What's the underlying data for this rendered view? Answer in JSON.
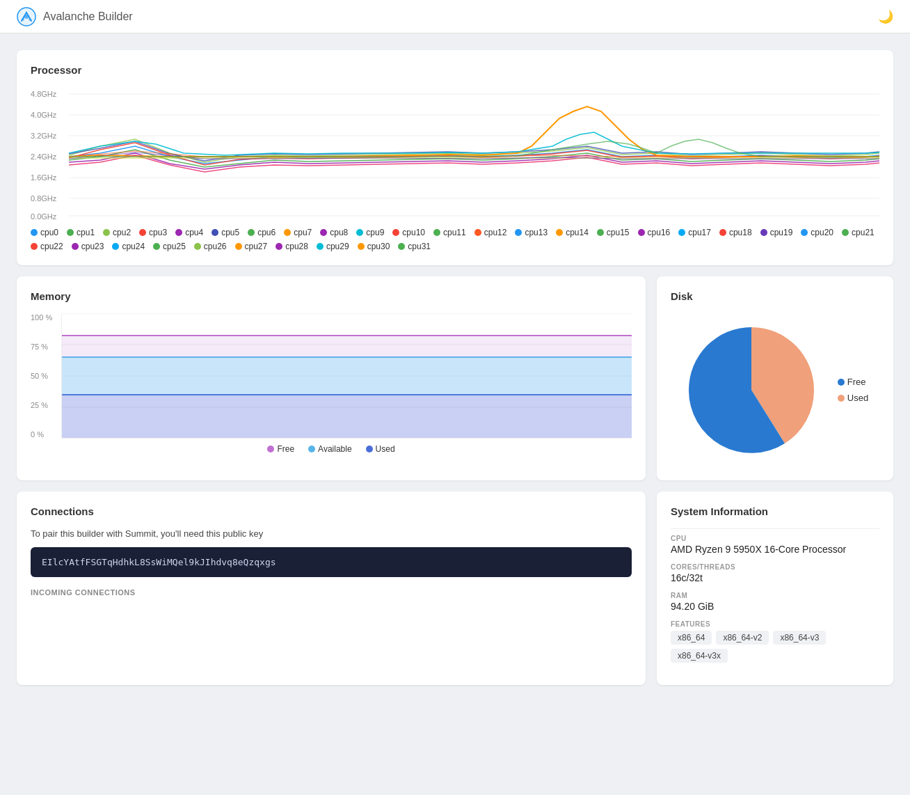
{
  "header": {
    "title": "Avalanche",
    "subtitle": "Builder",
    "logo_alt": "avalanche-logo"
  },
  "processor": {
    "title": "Processor",
    "y_labels": [
      "4.8GHz",
      "4.0GHz",
      "3.2GHz",
      "2.4GHz",
      "1.6GHz",
      "0.8GHz",
      "0.0GHz"
    ],
    "cpus": [
      {
        "name": "cpu0",
        "color": "#2196F3"
      },
      {
        "name": "cpu1",
        "color": "#4CAF50"
      },
      {
        "name": "cpu2",
        "color": "#8BC34A"
      },
      {
        "name": "cpu3",
        "color": "#f44336"
      },
      {
        "name": "cpu4",
        "color": "#9C27B0"
      },
      {
        "name": "cpu5",
        "color": "#3F51B5"
      },
      {
        "name": "cpu6",
        "color": "#4CAF50"
      },
      {
        "name": "cpu7",
        "color": "#FF9800"
      },
      {
        "name": "cpu8",
        "color": "#9C27B0"
      },
      {
        "name": "cpu9",
        "color": "#00BCD4"
      },
      {
        "name": "cpu10",
        "color": "#F44336"
      },
      {
        "name": "cpu11",
        "color": "#4CAF50"
      },
      {
        "name": "cpu12",
        "color": "#FF5722"
      },
      {
        "name": "cpu13",
        "color": "#2196F3"
      },
      {
        "name": "cpu14",
        "color": "#FF9800"
      },
      {
        "name": "cpu15",
        "color": "#4CAF50"
      },
      {
        "name": "cpu16",
        "color": "#9C27B0"
      },
      {
        "name": "cpu17",
        "color": "#03A9F4"
      },
      {
        "name": "cpu18",
        "color": "#F44336"
      },
      {
        "name": "cpu19",
        "color": "#673AB7"
      },
      {
        "name": "cpu20",
        "color": "#2196F3"
      },
      {
        "name": "cpu21",
        "color": "#4CAF50"
      },
      {
        "name": "cpu22",
        "color": "#F44336"
      },
      {
        "name": "cpu23",
        "color": "#9C27B0"
      },
      {
        "name": "cpu24",
        "color": "#03A9F4"
      },
      {
        "name": "cpu25",
        "color": "#4CAF50"
      },
      {
        "name": "cpu26",
        "color": "#8BC34A"
      },
      {
        "name": "cpu27",
        "color": "#FF9800"
      },
      {
        "name": "cpu28",
        "color": "#9C27B0"
      },
      {
        "name": "cpu29",
        "color": "#00BCD4"
      },
      {
        "name": "cpu30",
        "color": "#FF9800"
      },
      {
        "name": "cpu31",
        "color": "#4CAF50"
      }
    ]
  },
  "memory": {
    "title": "Memory",
    "y_labels": [
      "100%",
      "75%",
      "50%",
      "25%",
      "0%"
    ],
    "legend": [
      {
        "label": "Free",
        "color": "#c070d0"
      },
      {
        "label": "Available",
        "color": "#58b5e8"
      },
      {
        "label": "Used",
        "color": "#4a6dd8"
      }
    ],
    "used_pct": 35,
    "available_pct": 55,
    "free_pct": 82
  },
  "disk": {
    "title": "Disk",
    "legend": [
      {
        "label": "Free",
        "color": "#2979d0"
      },
      {
        "label": "Used",
        "color": "#f0a07a"
      }
    ],
    "free_pct": 52,
    "used_pct": 48
  },
  "connections": {
    "title": "Connections",
    "description": "To pair this builder with Summit, you'll need this public key",
    "public_key": "EIlcYAtfFSGTqHdhkL8SsWiMQel9kJIhdvq8eQzqxgs",
    "incoming_label": "INCOMING CONNECTIONS"
  },
  "system_info": {
    "title": "System Information",
    "cpu_label": "CPU",
    "cpu_value": "AMD Ryzen 9 5950X 16-Core Processor",
    "cores_label": "CORES/THREADS",
    "cores_value": "16c/32t",
    "ram_label": "RAM",
    "ram_value": "94.20 GiB",
    "features_label": "FEATURES",
    "features": [
      "x86_64",
      "x86_64-v2",
      "x86_64-v3",
      "x86_64-v3x"
    ]
  }
}
